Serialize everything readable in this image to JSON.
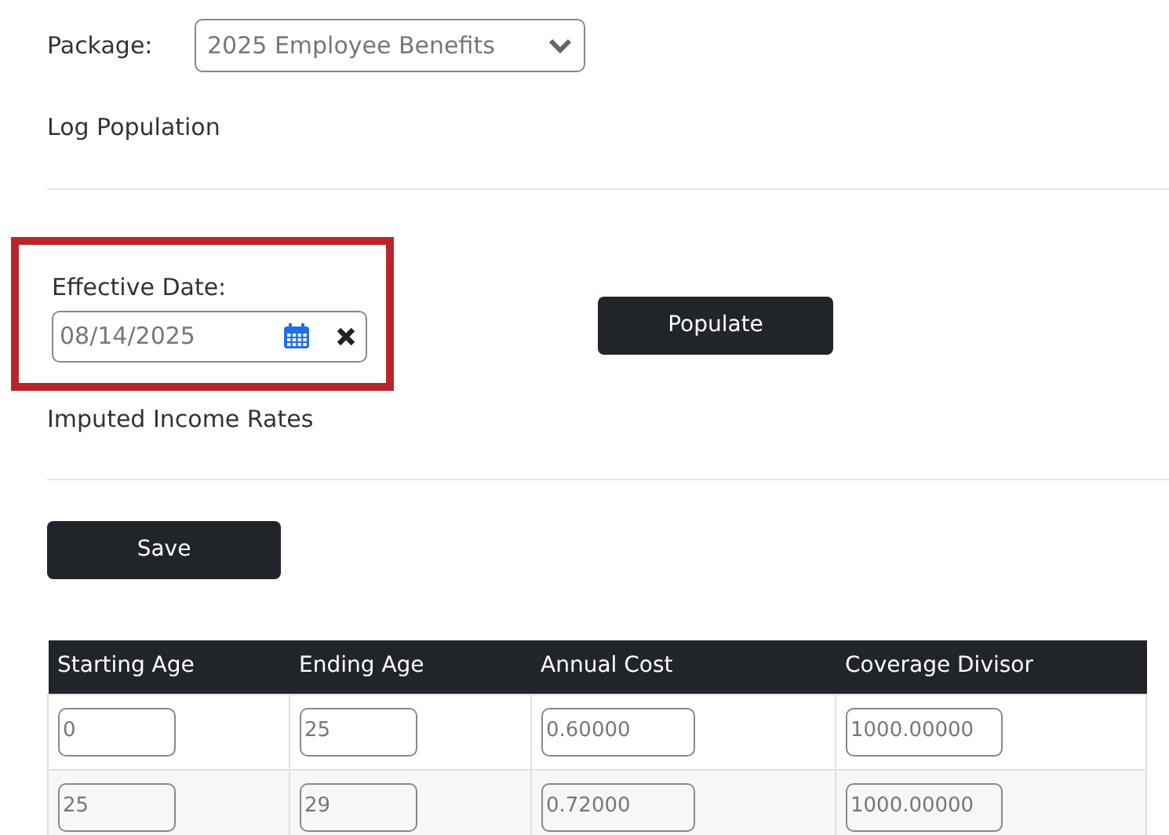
{
  "package": {
    "label": "Package:",
    "value": "2025 Employee Benefits"
  },
  "log_population": {
    "title": "Log Population",
    "effective_date": {
      "label": "Effective Date:",
      "value": "08/14/2025",
      "highlighted": true
    },
    "populate_button": "Populate"
  },
  "imputed_income_rates": {
    "title": "Imputed Income Rates",
    "save_button": "Save",
    "table": {
      "columns": [
        "Starting Age",
        "Ending Age",
        "Annual Cost",
        "Coverage Divisor"
      ],
      "rows": [
        [
          "0",
          "25",
          "0.60000",
          "1000.00000"
        ],
        [
          "25",
          "29",
          "0.72000",
          "1000.00000"
        ]
      ]
    }
  }
}
